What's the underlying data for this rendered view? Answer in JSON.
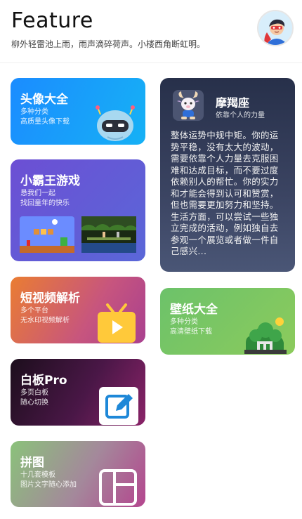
{
  "header": {
    "title": "Feature",
    "subtitle": "柳外轻雷池上雨，雨声滴碎荷声。小楼西角断虹明。"
  },
  "cards": {
    "avatar": {
      "title": "头像大全",
      "line1": "多种分类",
      "line2": "高质量头像下载",
      "icon": "robot-icon"
    },
    "game": {
      "title": "小霸王游戏",
      "line1": "恳我们一起",
      "line2": "找回童年的快乐",
      "icon": "retro-game-screenshots"
    },
    "video": {
      "title": "短视频解析",
      "line1": "多个平台",
      "line2": "无水印视频解析",
      "icon": "tv-play-icon"
    },
    "whiteboard": {
      "title": "白板Pro",
      "line1": "多页白板",
      "line2": "随心切换",
      "icon": "edit-icon"
    },
    "puzzle": {
      "title": "拼图",
      "line1": "十几套模板",
      "line2": "图片文字随心添加",
      "icon": "collage-layout-icon"
    },
    "zodiac": {
      "name": "摩羯座",
      "tagline": "依靠个人的力量",
      "text": "整体运势中规中矩。你的运势平稳，没有太大的波动，需要依靠个人力量去克服困难和达成目标，而不要过度依赖别人的帮忙。你的实力和才能会得到认可和赞赏，但也需要更加努力和坚持。生活方面，可以尝试一些独立完成的活动，例如独自去参观一个展览或者做一件自己感兴...",
      "icon": "capricorn-goat-icon"
    },
    "wallpaper": {
      "title": "壁纸大全",
      "line1": "多种分类",
      "line2": "高清壁纸下载",
      "icon": "green-scenery-icon"
    }
  },
  "colors": {
    "avatar_bg": "#1b8cff",
    "game_bg": "#6c4fd4",
    "video_bg": "#ea7d32",
    "whiteboard_bg": "#1c0e1c",
    "puzzle_bg": "#8ac27a",
    "zodiac_bg": "#27304a",
    "wallpaper_bg": "#6cc26a"
  }
}
